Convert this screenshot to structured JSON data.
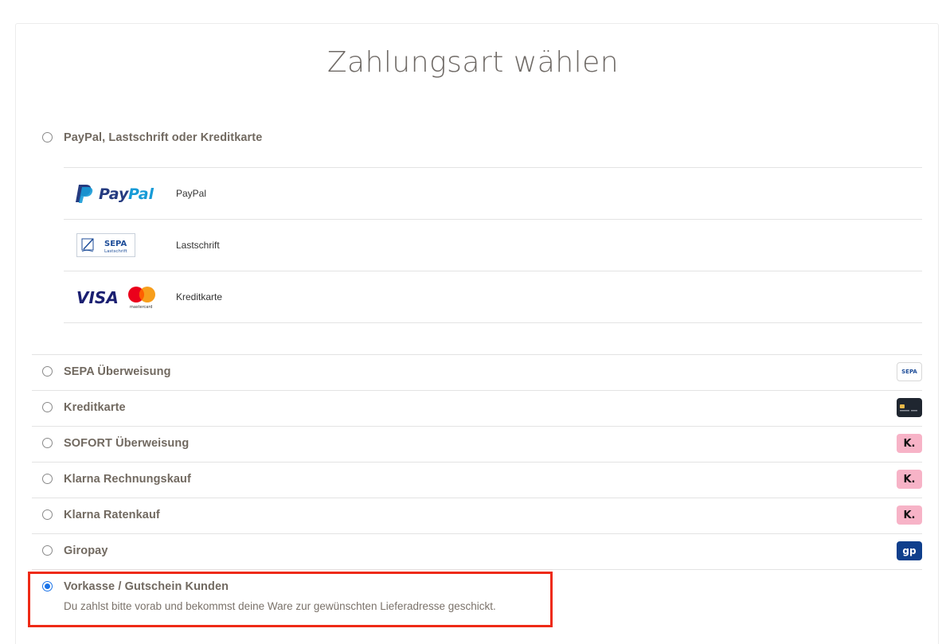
{
  "page": {
    "title": "Zahlungsart wählen"
  },
  "group_option": {
    "label": "PayPal, Lastschrift oder Kreditkarte",
    "sub_options": [
      {
        "label": "PayPal",
        "logo": "paypal-logo",
        "logo_text": "PayPal"
      },
      {
        "label": "Lastschrift",
        "logo": "sepa-lastschrift-logo",
        "logo_text": "SEPA",
        "logo_subtext": "Lastschrift"
      },
      {
        "label": "Kreditkarte",
        "logo": "visa-mastercard-logo",
        "logo_text": "VISA",
        "logo_subtext": "mastercard"
      }
    ]
  },
  "options": [
    {
      "label": "SEPA Überweisung",
      "badge": "sepa-badge",
      "badge_text": "SEPA"
    },
    {
      "label": "Kreditkarte",
      "badge": "credit-card-badge",
      "badge_text": ""
    },
    {
      "label": "SOFORT Überweisung",
      "badge": "klarna-badge",
      "badge_text": "K."
    },
    {
      "label": "Klarna Rechnungskauf",
      "badge": "klarna-badge",
      "badge_text": "K."
    },
    {
      "label": "Klarna Ratenkauf",
      "badge": "klarna-badge",
      "badge_text": "K."
    },
    {
      "label": "Giropay",
      "badge": "giropay-badge",
      "badge_text": "gp"
    }
  ],
  "selected_option": {
    "label": "Vorkasse / Gutschein Kunden",
    "description": "Du zahlst bitte vorab und bekommst deine Ware zur gewünschten Lieferadresse geschickt."
  },
  "colors": {
    "highlight": "#ee2a16",
    "radio_selected": "#1a73e8",
    "paypal_dark": "#253b80",
    "paypal_light": "#179bd7",
    "giropay": "#0f3f8c",
    "klarna": "#f7b3c7"
  }
}
